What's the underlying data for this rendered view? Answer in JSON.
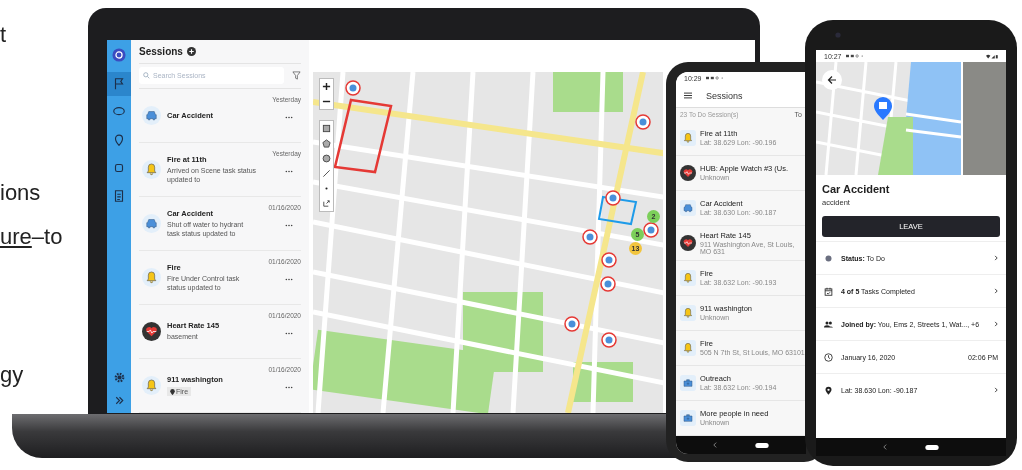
{
  "slide_fragments": [
    {
      "text": "t"
    },
    {
      "text": "ions"
    },
    {
      "underlined": "ure",
      "text": "–to"
    },
    {
      "text": "gy"
    }
  ],
  "laptop": {
    "sidebar": {
      "items": [
        {
          "kind": "flag",
          "selected": true
        },
        {
          "kind": "chat",
          "selected": false
        },
        {
          "kind": "pin",
          "selected": false
        },
        {
          "kind": "chip",
          "selected": false
        },
        {
          "kind": "clipboard",
          "selected": false
        }
      ]
    },
    "sessions": {
      "title": "Sessions",
      "search_placeholder": "Search Sessions",
      "items": [
        {
          "kind": "car",
          "title": "Car Accident",
          "date": "Yesterday"
        },
        {
          "kind": "bell",
          "title": "Fire at 11th",
          "date": "Yesterday",
          "description": "Arrived on Scene task status updated to"
        },
        {
          "kind": "car",
          "title": "Car Accident",
          "date": "01/16/2020",
          "description": "Shut off water to hydrant task status updated to"
        },
        {
          "kind": "bell",
          "title": "Fire",
          "date": "01/16/2020",
          "description": "Fire Under Control task status updated to"
        },
        {
          "kind": "heart",
          "title": "Heart Rate 145",
          "date": "01/16/2020",
          "description": "basement"
        },
        {
          "kind": "bell",
          "title": "911 washington",
          "date": "01/16/2020",
          "tag": "Fire"
        }
      ]
    },
    "map": {
      "clusters": [
        {
          "label": "2",
          "color": "#7ccf5a"
        },
        {
          "label": "5",
          "color": "#7ccf5a"
        },
        {
          "label": "13",
          "color": "#f2c53d"
        }
      ]
    }
  },
  "phone_list": {
    "time": "10:29",
    "title": "Sessions",
    "summary": "23 To Do Session(s)",
    "tab": "To",
    "items": [
      {
        "kind": "bell",
        "title": "Fire at 11th",
        "subtitle": "Lat: 38.629 Lon: -90.196"
      },
      {
        "kind": "heart",
        "title": "HUB: Apple Watch #3 (Us.",
        "subtitle": "Unknown"
      },
      {
        "kind": "car",
        "title": "Car Accident",
        "subtitle": "Lat: 38.630 Lon: -90.187"
      },
      {
        "kind": "heart",
        "title": "Heart Rate 145",
        "subtitle": "911 Washington Ave, St Louis, MO 631"
      },
      {
        "kind": "bell",
        "title": "Fire",
        "subtitle": "Lat: 38.632 Lon: -90.193"
      },
      {
        "kind": "bell",
        "title": "911 washington",
        "subtitle": "Unknown"
      },
      {
        "kind": "bell",
        "title": "Fire",
        "subtitle": "505 N 7th St, St Louis, MO 63101"
      },
      {
        "kind": "kit",
        "title": "Outreach",
        "subtitle": "Lat: 38.632 Lon: -90.194"
      },
      {
        "kind": "kit",
        "title": "More people in need",
        "subtitle": "Unknown"
      }
    ]
  },
  "phone_detail": {
    "time": "10:27",
    "title": "Car Accident",
    "subtitle": "accident",
    "button": "LEAVE",
    "rows": [
      {
        "kind": "status",
        "text": "**Status:** To Do"
      },
      {
        "kind": "tasks",
        "text": "**4 of 5** Tasks Completed"
      },
      {
        "kind": "people",
        "text": "**Joined by:** You, Ems 2, Streets 1, Wat..., +6"
      },
      {
        "kind": "date",
        "text": "January 16, 2020",
        "trailing": "02:06 PM"
      },
      {
        "kind": "location",
        "text": "Lat: 38.630 Lon: -90.187"
      }
    ]
  }
}
